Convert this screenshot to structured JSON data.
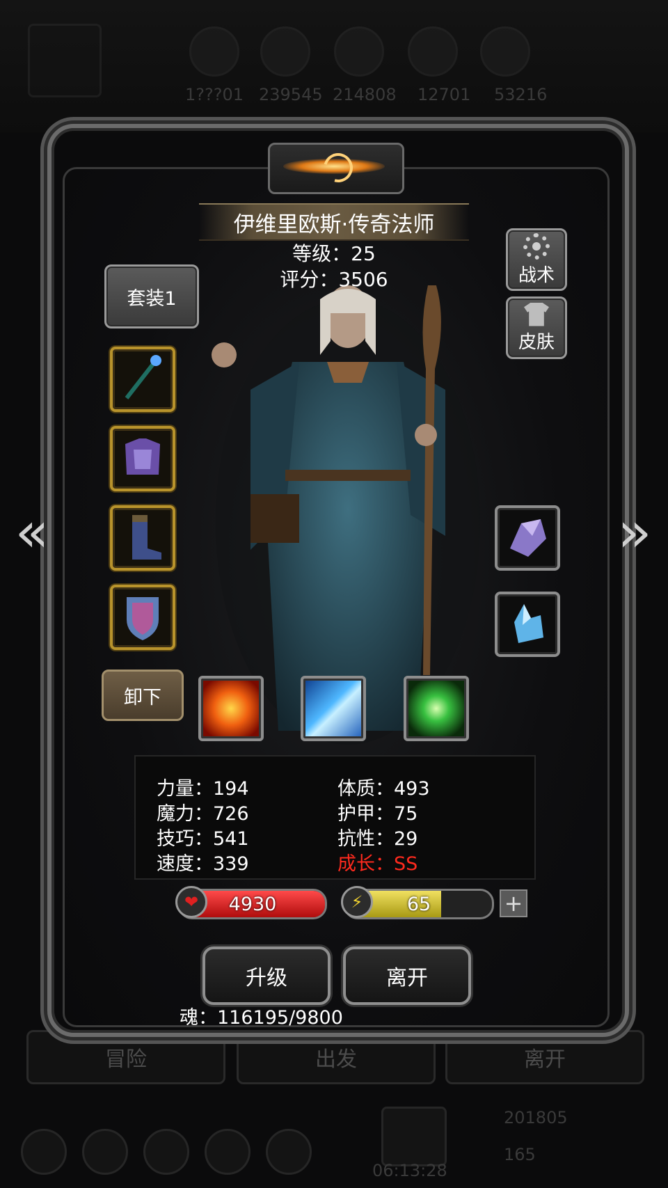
{
  "background": {
    "top_values": [
      "1???01",
      "239545",
      "214808",
      "12701",
      "53216"
    ],
    "bottom_tabs": [
      "冒险",
      "出发",
      "离开"
    ],
    "gold": "201805",
    "gems": "165",
    "timer": "06:13:28"
  },
  "hero": {
    "name": "伊维里欧斯·传奇法师",
    "level_text": "等级：25",
    "score_text": "评分：3506"
  },
  "buttons": {
    "set": "套装1",
    "tactics": "战术",
    "skin": "皮肤",
    "unequip": "卸下",
    "upgrade": "升级",
    "leave": "离开"
  },
  "equipment_slots": [
    {
      "icon": "staff-icon"
    },
    {
      "icon": "armor-icon"
    },
    {
      "icon": "boots-icon"
    },
    {
      "icon": "shield-icon"
    }
  ],
  "gem_slots": [
    {
      "icon": "amethyst-crystal-icon"
    },
    {
      "icon": "ice-crystal-icon"
    }
  ],
  "skills": [
    {
      "icon": "fire-skill-icon"
    },
    {
      "icon": "frost-skill-icon"
    },
    {
      "icon": "nature-skill-icon"
    }
  ],
  "stats": {
    "strength": "力量：194",
    "constitution": "体质：493",
    "magic": "魔力：726",
    "armor": "护甲：75",
    "skill": "技巧：541",
    "resistance": "抗性：29",
    "speed": "速度：339",
    "growth": "成长：SS"
  },
  "bars": {
    "hp": "4930",
    "hp_fill": 1.0,
    "energy": "65",
    "energy_fill": 0.65
  },
  "soul": "魂：116195/9800",
  "colors": {
    "growth_red": "#ff2a1e",
    "hp_red": "#d91a1a",
    "energy_yellow": "#e2d23a",
    "slot_gold": "#b8932c"
  }
}
